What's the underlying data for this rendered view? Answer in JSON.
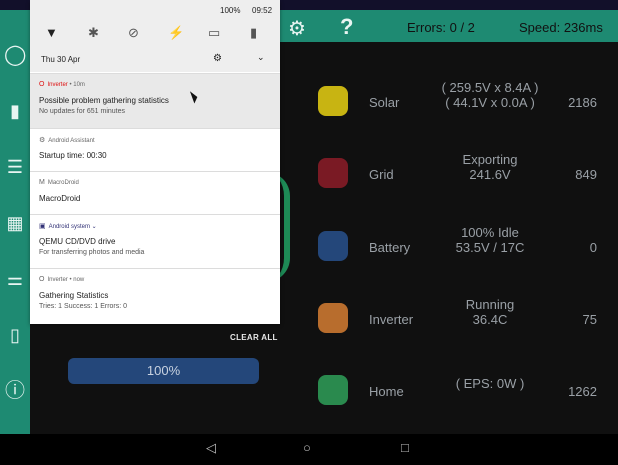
{
  "header": {
    "errors": "Errors:  0 / 2",
    "speed": "Speed: 236ms"
  },
  "rows": [
    {
      "label": "Solar",
      "value_line1": "( 259.5V x 8.4A )",
      "value_line2": "( 44.1V x 0.0A )",
      "number": "2186",
      "color": "#c8b412"
    },
    {
      "label": "Grid",
      "value_line1": "Exporting",
      "value_line2": "241.6V",
      "number": "849",
      "color": "#7a1a24"
    },
    {
      "label": "Battery",
      "value_line1": "100% Idle",
      "value_line2": "53.5V / 17C",
      "number": "0",
      "color": "#24477a"
    },
    {
      "label": "Inverter",
      "value_line1": "Running",
      "value_line2": "36.4C",
      "number": "75",
      "color": "#b86d2d"
    },
    {
      "label": "Home",
      "value_line1": "( EPS:  0W )",
      "value_line2": "",
      "number": "1262",
      "color": "#2a8a4e"
    }
  ],
  "progress": {
    "label": "100%",
    "value_percent": 100
  },
  "shade": {
    "battery": "100%",
    "time": "09:52",
    "date": "Thu 30 Apr",
    "clear_all": "CLEAR ALL",
    "notifications": [
      {
        "app": "Inverter",
        "meta": "• 10m",
        "title": "Possible problem gathering statistics",
        "text": "No updates for 651 minutes"
      },
      {
        "app": "Android Assistant",
        "meta": "",
        "title": "Startup time: 00:30",
        "text": ""
      },
      {
        "app": "MacroDroid",
        "meta": "",
        "title": "MacroDroid",
        "text": ""
      },
      {
        "app": "Android system",
        "meta": "⌄",
        "title": "QEMU CD/DVD drive",
        "text": "For transferring photos and media"
      },
      {
        "app": "Inverter",
        "meta": "• now",
        "title": "Gathering Statistics",
        "text": "Tries: 1 Success: 1 Errors: 0"
      }
    ]
  }
}
